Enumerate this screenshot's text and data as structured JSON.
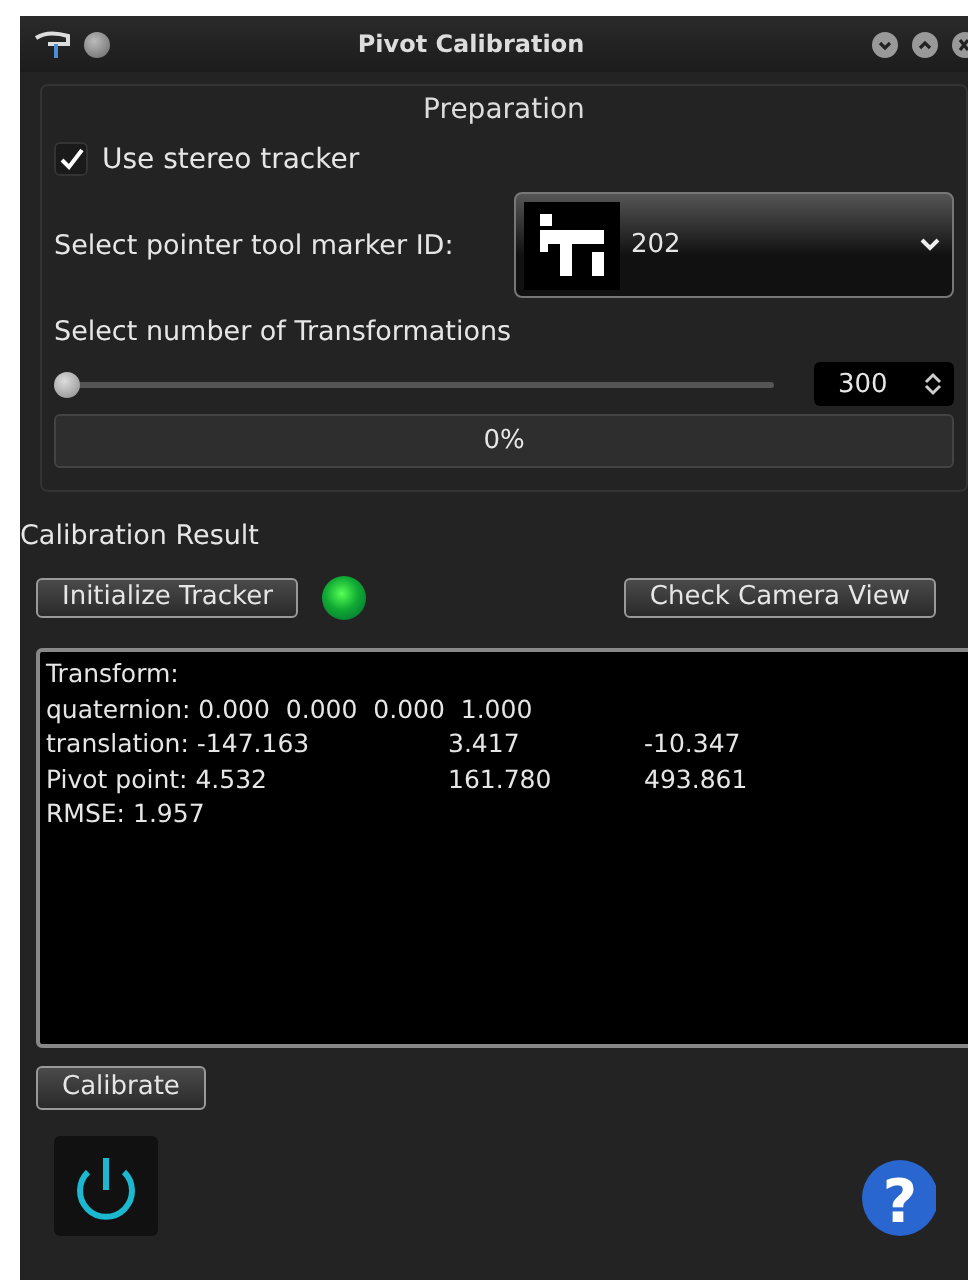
{
  "window": {
    "title": "Pivot Calibration"
  },
  "preparation": {
    "title": "Preparation",
    "stereo_tracker": {
      "label": "Use stereo tracker",
      "checked": true
    },
    "marker": {
      "label": "Select pointer tool marker ID:",
      "value": "202"
    },
    "transformations": {
      "label": "Select number of Transformations",
      "level": 0,
      "value": "300"
    },
    "progress": {
      "level": 0,
      "text": "0%"
    }
  },
  "result": {
    "title": "Calibration Result",
    "initialize_button": "Initialize Tracker",
    "tracker_ready": true,
    "camera_button": "Check Camera View",
    "output": [
      [
        "Transform:"
      ],
      [
        "quaternion: 0.000  0.000  0.000  1.000"
      ],
      [
        "translation: -147.163",
        "3.417",
        "-10.347"
      ],
      [
        "Pivot point: 4.532",
        "161.780",
        "493.861"
      ],
      [
        "RMSE: 1.957"
      ]
    ]
  },
  "calibrate_button": "Calibrate",
  "help_button": "?"
}
